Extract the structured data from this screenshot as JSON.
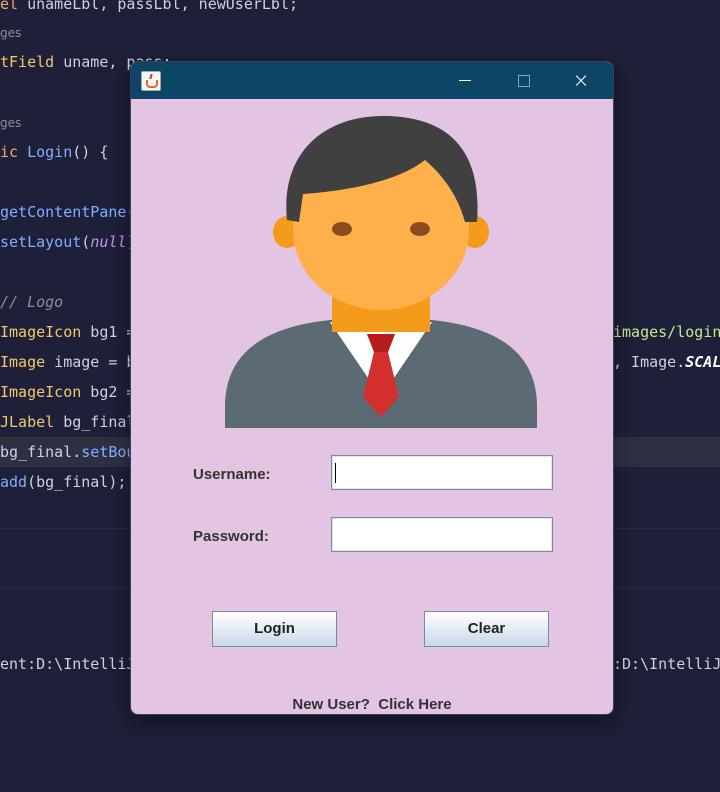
{
  "ide": {
    "hints": [
      "ges",
      "ges"
    ],
    "code_lines": [
      {
        "segments": [
          {
            "t": "el ",
            "c": "kw"
          },
          {
            "t": "unameLbl, passLbl, newUserLbl;",
            "c": ""
          }
        ]
      },
      {
        "segments": [
          {
            "t": "tField",
            "c": "ty"
          },
          {
            "t": " uname, pass;",
            "c": ""
          }
        ]
      },
      {
        "segments": [
          {
            "t": "ic ",
            "c": "kw"
          },
          {
            "t": "Login",
            "c": "fn"
          },
          {
            "t": "() {",
            "c": ""
          }
        ]
      },
      {
        "segments": [
          {
            "t": "getContentPane",
            "c": "fn"
          },
          {
            "t": "(",
            "c": ""
          }
        ]
      },
      {
        "segments": [
          {
            "t": "setLayout",
            "c": "fn"
          },
          {
            "t": "(",
            "c": ""
          },
          {
            "t": "null",
            "c": "it"
          },
          {
            "t": ")",
            "c": ""
          }
        ]
      },
      {
        "segments": [
          {
            "t": "// Logo",
            "c": "cm"
          }
        ]
      },
      {
        "segments": [
          {
            "t": "ImageIcon",
            "c": "ty"
          },
          {
            "t": " bg1 =",
            "c": ""
          }
        ]
      },
      {
        "segments": [
          {
            "t": "Image",
            "c": "ty"
          },
          {
            "t": " image = b",
            "c": ""
          }
        ]
      },
      {
        "segments": [
          {
            "t": "ImageIcon",
            "c": "ty"
          },
          {
            "t": " bg2 =",
            "c": ""
          }
        ]
      },
      {
        "segments": [
          {
            "t": "JLabel",
            "c": "ty"
          },
          {
            "t": " bg_final",
            "c": ""
          }
        ]
      },
      {
        "segments": [
          {
            "t": "bg_final.",
            "c": ""
          },
          {
            "t": "setBou",
            "c": "fn"
          }
        ]
      },
      {
        "segments": [
          {
            "t": "add",
            "c": "fn"
          },
          {
            "t": "(bg_final);",
            "c": ""
          }
        ]
      }
    ],
    "right_overflow": [
      {
        "segments": [
          {
            "t": "images/login_",
            "c": "str"
          }
        ]
      },
      {
        "segments": [
          {
            "t": ", Image.",
            "c": ""
          },
          {
            "t": "SCAL",
            "c": "bold"
          }
        ]
      }
    ],
    "console": {
      "left": "ent:D:\\IntelliJ",
      "right": ":D:\\IntelliJ"
    }
  },
  "window": {
    "title": "",
    "icon": "java-cup-icon",
    "controls": {
      "minimize": "minimize-icon",
      "maximize": "maximize-icon",
      "close": "×"
    },
    "username_label": "Username:",
    "password_label": "Password:",
    "username_value": "",
    "password_value": "",
    "login_button": "Login",
    "clear_button": "Clear",
    "new_user_link": "New User?  Click Here"
  },
  "colors": {
    "window_bg": "#e3c4e2",
    "titlebar": "#0d4566",
    "ide_bg": "#1e1f38"
  }
}
